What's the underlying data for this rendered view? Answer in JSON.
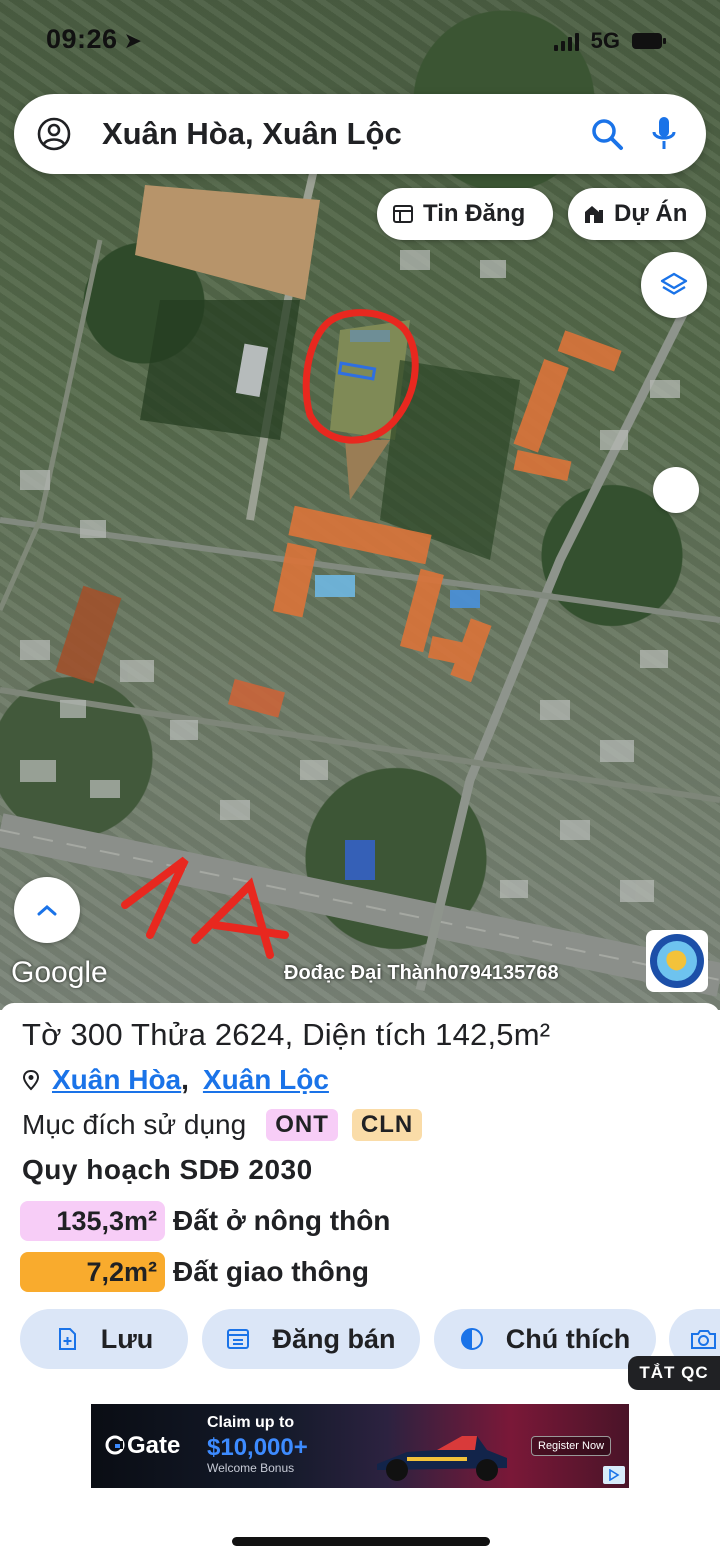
{
  "status_bar": {
    "time": "09:26",
    "network": "5G"
  },
  "search": {
    "query": "Xuân Hòa, Xuân Lộc"
  },
  "chips": {
    "tin_dang": "Tin Đăng",
    "du_an": "Dự Án"
  },
  "map": {
    "attribution": "Google",
    "watermark": "Đođạc Đại Thành0794135768",
    "annotation": "1A"
  },
  "parcel": {
    "title": "Tờ 300 Thửa 2624, Diện tích 142,5m²",
    "ward": "Xuân Hòa",
    "district": "Xuân Lộc",
    "purpose_label": "Mục đích sử dụng",
    "purpose_codes": [
      "ONT",
      "CLN"
    ],
    "planning_title": "Quy hoạch SDĐ 2030",
    "planning": [
      {
        "area": "135,3m²",
        "label": "Đất ở nông thôn",
        "color": "#f7cdf7"
      },
      {
        "area": "7,2m²",
        "label": "Đất giao thông",
        "color": "#f9ab2d"
      }
    ]
  },
  "actions": {
    "save": "Lưu",
    "sell": "Đăng bán",
    "legend": "Chú thích"
  },
  "ad_off": "TẮT QC",
  "ad": {
    "brand": "Gate",
    "line1": "Claim up to",
    "line2": "$10,000+",
    "line3": "Welcome Bonus",
    "cta": "Register Now"
  },
  "colors": {
    "accent": "#1a73e8",
    "button_bg": "#dbe6f7",
    "annotation_red": "#e8281f"
  }
}
